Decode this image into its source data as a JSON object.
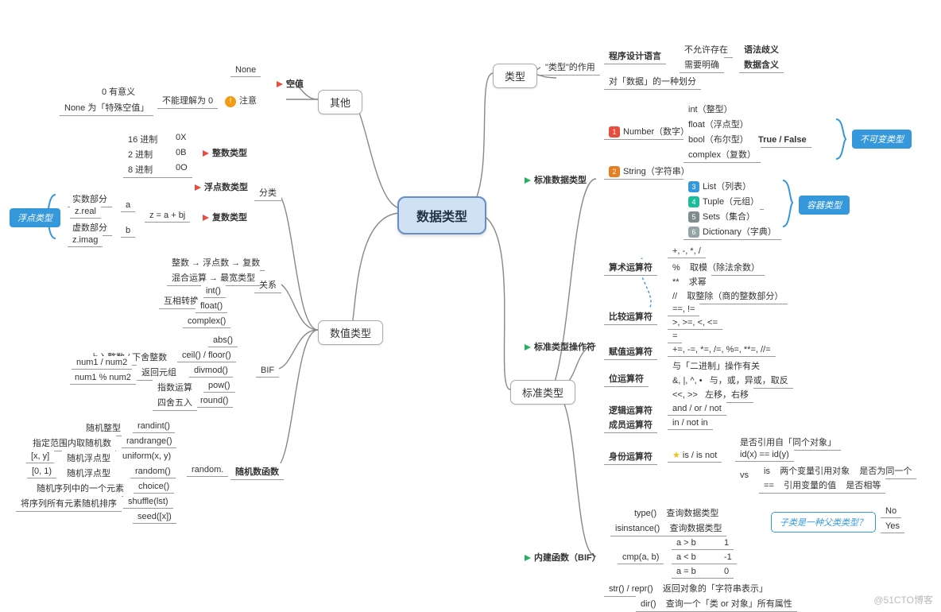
{
  "root": "数据类型",
  "watermark": "@51CTO博客",
  "left": {
    "other": {
      "title": "其他",
      "none": "None",
      "kongzhi": "空值",
      "zhuyi": "注意",
      "buneng": "不能理解为 0",
      "zero": "0 有意义",
      "nonewei": "None 为「特殊空值」"
    },
    "numeric": {
      "title": "数值类型",
      "cat": "分类",
      "rel": "关系",
      "bif": "BIF",
      "rand": "随机数函数",
      "randprefix": "random.",
      "intType": "整数类型",
      "floatType": "浮点数类型",
      "complexType": "复数类型",
      "base16": "16 进制",
      "p16": "0X",
      "base2": "2 进制",
      "p2": "0B",
      "base8": "8 进制",
      "p8": "0O",
      "zeq": "z = a + bj",
      "za": "a",
      "zb": "b",
      "real": "实数部分",
      "zreal": "z.real",
      "imag": "虚数部分",
      "zimag": "z.imag",
      "floatCall": "浮点类型",
      "rel1": "整数 → 浮点数 → 复数",
      "rel2": "混合运算 → 最宽类型",
      "rel_conv": "互相转换",
      "intf": "int()",
      "floatf": "float()",
      "complexf": "complex()",
      "absf": "abs()",
      "ceil": "ceil() / floor()",
      "ceil_l": "上入整数 / 下舍整数",
      "divmod": "divmod()",
      "divmod_l": "返回元组",
      "div1": "num1 / num2",
      "div2": "num1 % num2",
      "pow": "pow()",
      "pow_l": "指数运算",
      "round": "round()",
      "round_l": "四舍五入",
      "r_randint": "randint()",
      "r_randint_l": "随机整型",
      "r_range": "randrange()",
      "r_range_l": "指定范围内取随机数",
      "r_uniform": "uniform(x, y)",
      "r_uniform_l": "随机浮点型",
      "r_uniform_r": "[x, y]",
      "r_random": "random()",
      "r_random_l": "随机浮点型",
      "r_random_r": "[0, 1)",
      "r_choice": "choice()",
      "r_choice_l": "随机序列中的一个元素",
      "r_shuffle": "shuffle(lst)",
      "r_shuffle_l": "将序列所有元素随机排序",
      "r_seed": "seed([x])"
    }
  },
  "right": {
    "type": {
      "title": "类型",
      "role": "\"类型\"的作用",
      "r1a": "程序设计语言",
      "r1b": "不允许存在",
      "r1c": "语法歧义",
      "r2b": "需要明确",
      "r2c": "数据含义",
      "r3": "对「数据」的一种划分"
    },
    "std": {
      "title": "标准数据类型",
      "n1": "Number（数字）",
      "n2": "String（字符串）",
      "n3": "List（列表）",
      "n4": "Tuple（元组）",
      "n5": "Sets（集合）",
      "n6": "Dictionary（字典）",
      "t_int": "int（整型）",
      "t_float": "float（浮点型）",
      "t_bool": "bool（布尔型）",
      "t_bool_v": "True / False",
      "t_complex": "complex（复数）",
      "immutable": "不可变类型",
      "container": "容器类型"
    },
    "ops": {
      "title": "标准类型",
      "ops": "标准类型操作符",
      "arith": "算术运算符",
      "cmp": "比较运算符",
      "assign": "赋值运算符",
      "bit": "位运算符",
      "logic": "逻辑运算符",
      "member": "成员运算符",
      "ident": "身份运算符",
      "a1": "+, -, *, /",
      "a2": "%",
      "a2d": "取模（除法余数）",
      "a3": "**",
      "a3d": "求幂",
      "a4": "//",
      "a4d": "取整除（商的整数部分）",
      "c1": "==, !=",
      "c2": ">, >=, <, <=",
      "c3": "=",
      "as1": "+=, -=, *=, /=, %=, **=, //=",
      "bit1a": "与「二进制」操作有关",
      "bit2": "&, |, ^, •",
      "bit2d": "与，或，异或，取反",
      "bit3": "<<, >>",
      "bit3d": "左移，右移",
      "logic1": "and / or / not",
      "mem1": "in / not in",
      "id_star": "is / is not",
      "id1": "是否引用自「同个对象」",
      "id2": "id(x) == id(y)",
      "vs": "vs",
      "vs_is": "is",
      "vs_is_d": "两个变量引用对象",
      "vs_is_r": "是否为同一个",
      "vs_eq": "==",
      "vs_eq_d": "引用变量的值",
      "vs_eq_r": "是否相等"
    },
    "bif": {
      "title": "内建函数（BIF）",
      "type": "type()",
      "type_d": "查询数据类型",
      "isinst": "isinstance()",
      "isinst_d": "查询数据类型",
      "q": "子类是一种父类类型？",
      "no": "No",
      "yes": "Yes",
      "cmp": "cmp(a, b)",
      "c1a": "a > b",
      "c1b": "1",
      "c2a": "a < b",
      "c2b": "-1",
      "c3a": "a = b",
      "c3b": "0",
      "strrepr": "str() / repr()",
      "strrepr_d": "返回对象的「字符串表示」",
      "dir": "dir()",
      "dir_d": "查询一个「类 or 对象」所有属性"
    }
  }
}
